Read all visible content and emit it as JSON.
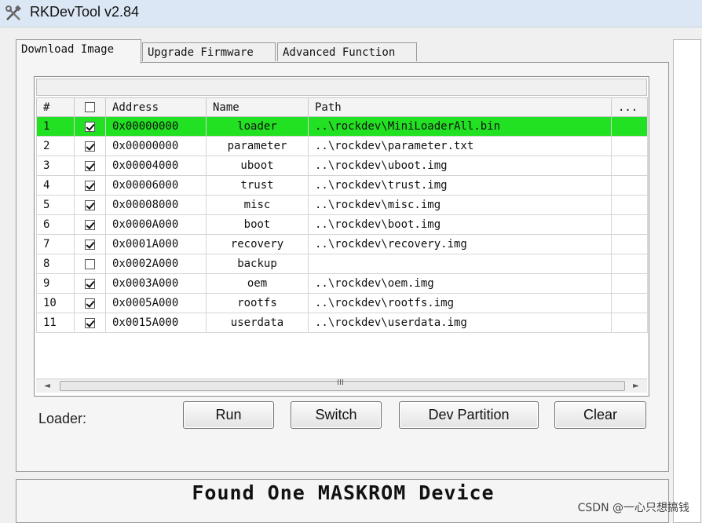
{
  "window": {
    "title": "RKDevTool v2.84"
  },
  "tabs": [
    {
      "label": "Download Image",
      "active": true
    },
    {
      "label": "Upgrade Firmware",
      "active": false
    },
    {
      "label": "Advanced Function",
      "active": false
    }
  ],
  "table": {
    "headers": {
      "num": "#",
      "check": "☐",
      "address": "Address",
      "name": "Name",
      "path": "Path",
      "more": "..."
    },
    "rows": [
      {
        "num": "1",
        "checked": true,
        "address": "0x00000000",
        "name": "loader",
        "path": "..\\rockdev\\MiniLoaderAll.bin",
        "selected": true
      },
      {
        "num": "2",
        "checked": true,
        "address": "0x00000000",
        "name": "parameter",
        "path": "..\\rockdev\\parameter.txt",
        "selected": false
      },
      {
        "num": "3",
        "checked": true,
        "address": "0x00004000",
        "name": "uboot",
        "path": "..\\rockdev\\uboot.img",
        "selected": false
      },
      {
        "num": "4",
        "checked": true,
        "address": "0x00006000",
        "name": "trust",
        "path": "..\\rockdev\\trust.img",
        "selected": false
      },
      {
        "num": "5",
        "checked": true,
        "address": "0x00008000",
        "name": "misc",
        "path": "..\\rockdev\\misc.img",
        "selected": false
      },
      {
        "num": "6",
        "checked": true,
        "address": "0x0000A000",
        "name": "boot",
        "path": "..\\rockdev\\boot.img",
        "selected": false
      },
      {
        "num": "7",
        "checked": true,
        "address": "0x0001A000",
        "name": "recovery",
        "path": "..\\rockdev\\recovery.img",
        "selected": false
      },
      {
        "num": "8",
        "checked": false,
        "address": "0x0002A000",
        "name": "backup",
        "path": "",
        "selected": false
      },
      {
        "num": "9",
        "checked": true,
        "address": "0x0003A000",
        "name": "oem",
        "path": "..\\rockdev\\oem.img",
        "selected": false
      },
      {
        "num": "10",
        "checked": true,
        "address": "0x0005A000",
        "name": "rootfs",
        "path": "..\\rockdev\\rootfs.img",
        "selected": false
      },
      {
        "num": "11",
        "checked": true,
        "address": "0x0015A000",
        "name": "userdata",
        "path": "..\\rockdev\\userdata.img",
        "selected": false
      }
    ],
    "selected_color": "#22e022"
  },
  "scrollbar": {
    "grip": "III"
  },
  "loader_label": "Loader:",
  "buttons": {
    "run": "Run",
    "switch": "Switch",
    "dev_partition": "Dev Partition",
    "clear": "Clear"
  },
  "status": {
    "text": "Found One MASKROM Device"
  },
  "watermark": {
    "text": "CSDN @一心只想搞钱"
  }
}
